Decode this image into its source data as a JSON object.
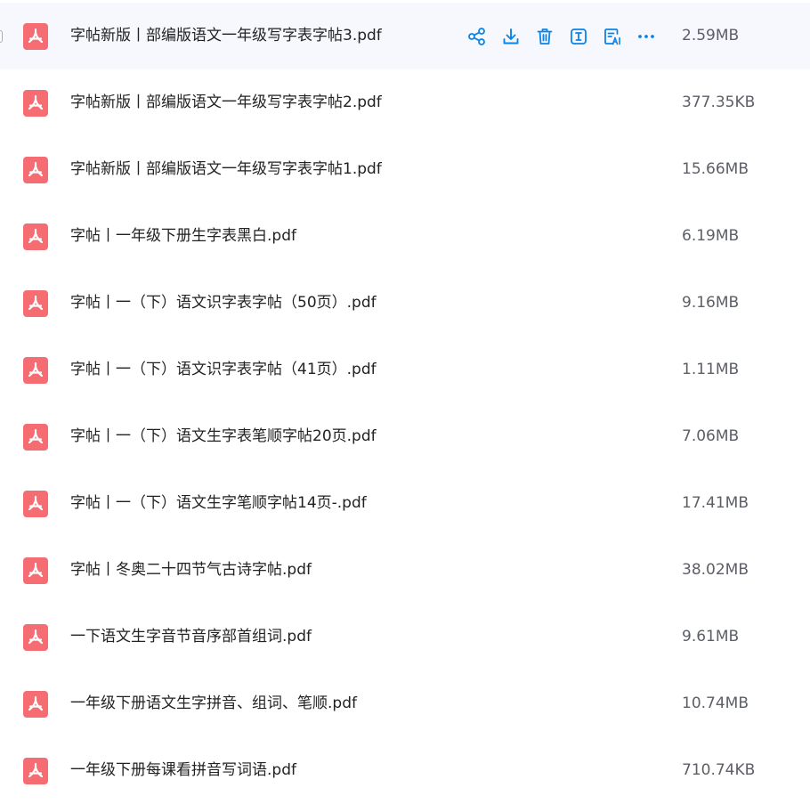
{
  "files": [
    {
      "name": "字帖新版丨部编版语文一年级写字表字帖3.pdf",
      "size": "2.59MB",
      "icon": "pdf-icon"
    },
    {
      "name": "字帖新版丨部编版语文一年级写字表字帖2.pdf",
      "size": "377.35KB",
      "icon": "pdf-icon"
    },
    {
      "name": "字帖新版丨部编版语文一年级写字表字帖1.pdf",
      "size": "15.66MB",
      "icon": "pdf-icon"
    },
    {
      "name": "字帖丨一年级下册生字表黑白.pdf",
      "size": "6.19MB",
      "icon": "pdf-icon"
    },
    {
      "name": "字帖丨一（下）语文识字表字帖（50页）.pdf",
      "size": "9.16MB",
      "icon": "pdf-icon"
    },
    {
      "name": "字帖丨一（下）语文识字表字帖（41页）.pdf",
      "size": "1.11MB",
      "icon": "pdf-icon"
    },
    {
      "name": "字帖丨一（下）语文生字表笔顺字帖20页.pdf",
      "size": "7.06MB",
      "icon": "pdf-icon"
    },
    {
      "name": "字帖丨一（下）语文生字笔顺字帖14页-.pdf",
      "size": "17.41MB",
      "icon": "pdf-icon"
    },
    {
      "name": "字帖丨冬奥二十四节气古诗字帖.pdf",
      "size": "38.02MB",
      "icon": "pdf-icon"
    },
    {
      "name": "一下语文生字音节音序部首组词.pdf",
      "size": "9.61MB",
      "icon": "pdf-icon"
    },
    {
      "name": "一年级下册语文生字拼音、组词、笔顺.pdf",
      "size": "10.74MB",
      "icon": "pdf-icon"
    },
    {
      "name": "一年级下册每课看拼音写词语.pdf",
      "size": "710.74KB",
      "icon": "pdf-icon"
    }
  ],
  "hovered_row_actions": [
    {
      "icon": "share-icon"
    },
    {
      "icon": "download-icon"
    },
    {
      "icon": "delete-icon"
    },
    {
      "icon": "rename-icon"
    },
    {
      "icon": "ai-summary-icon"
    },
    {
      "icon": "more-icon"
    }
  ],
  "colors": {
    "pdf_icon": "#f56c73",
    "action_icon": "#0a84e8",
    "hover_row_bg": "#f7f8fd",
    "file_name_text": "#222222",
    "file_size_text": "#5c5f66"
  }
}
